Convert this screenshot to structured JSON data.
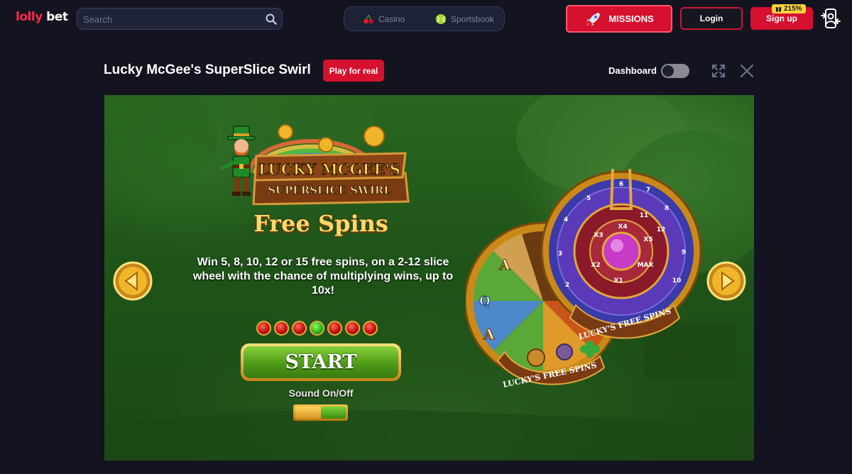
{
  "brand": {
    "part1": "lolly",
    "part2": "bet"
  },
  "search": {
    "placeholder": "Search"
  },
  "nav_tabs": [
    {
      "label": "Casino",
      "icon": "cherry-icon"
    },
    {
      "label": "Sportsbook",
      "icon": "tennis-ball-icon"
    }
  ],
  "header_buttons": {
    "missions": "MISSIONS",
    "login": "Login",
    "signup": "Sign up",
    "signup_badge": "215%"
  },
  "game": {
    "title": "Lucky McGee's SuperSlice Swirl",
    "play_real": "Play for real",
    "dashboard_label": "Dashboard",
    "dashboard_enabled": false
  },
  "game_screen": {
    "logo_line1": "LUCKY MCGEE'S",
    "logo_line2": "SUPERSLICE SWIRL",
    "heading": "Free Spins",
    "description": "Win 5, 8, 10, 12 or 15 free spins, on a 2-12 slice wheel with the chance of multiplying wins, up to 10x!",
    "page_count": 7,
    "active_page": 4,
    "start_label": "START",
    "sound_label": "Sound On/Off",
    "wheel_outer_label": "LUCKY'S FREE SPINS",
    "wheel_inner_label": "LUCKY'S FREE SPINS",
    "wheel_numbers": [
      "6",
      "7",
      "8",
      "9",
      "10",
      "11",
      "12",
      "2",
      "3",
      "4",
      "5"
    ],
    "wheel_multipliers": [
      "X4",
      "X5",
      "MAX",
      "X1",
      "X2",
      "X3"
    ],
    "wheel_symbols": [
      "A",
      "Q",
      "A"
    ]
  },
  "colors": {
    "brand_red": "#d6102f",
    "background": "#13141f",
    "accent_yellow": "#ffd43b"
  }
}
